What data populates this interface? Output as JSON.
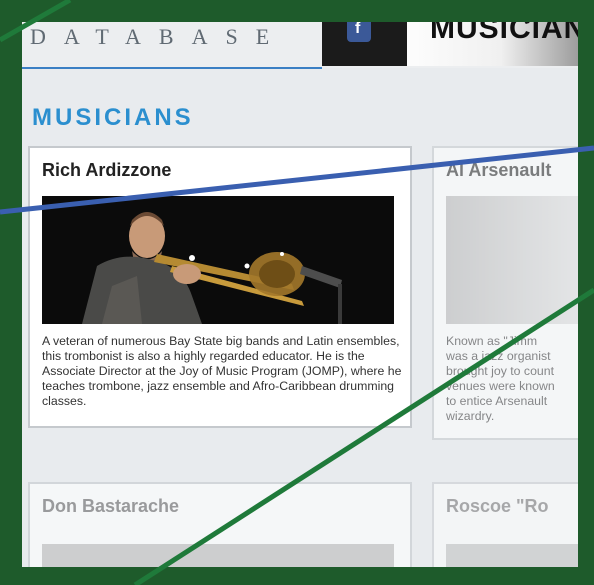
{
  "header": {
    "logo_text": "DATABASE",
    "facebook_icon_glyph": "f",
    "banner_text": "MUSICIAN"
  },
  "page": {
    "title": "MUSICIANS"
  },
  "musicians": [
    {
      "name": "Rich Ardizzone",
      "description": "A veteran of numerous Bay State big bands and Latin ensembles, this trombonist is also a highly regarded educator. He is the Associate Director at the Joy of Music Program (JOMP), where he teaches trombone, jazz ensemble and Afro-Caribbean drumming classes."
    },
    {
      "name": "Al Arsenault",
      "description": "Known as \"Jimm\nwas a jazz organist\nbrought joy to count\nvenues were known\nto entice Arsenault\nwizardry."
    },
    {
      "name": "Don Bastarache",
      "description": ""
    },
    {
      "name": "Roscoe \"Ro",
      "description": ""
    }
  ],
  "colors": {
    "frame": "#1e5b2b",
    "title": "#2b8fcf",
    "overlay_green": "#1f7a3a",
    "overlay_blue": "#3a5fb0"
  }
}
